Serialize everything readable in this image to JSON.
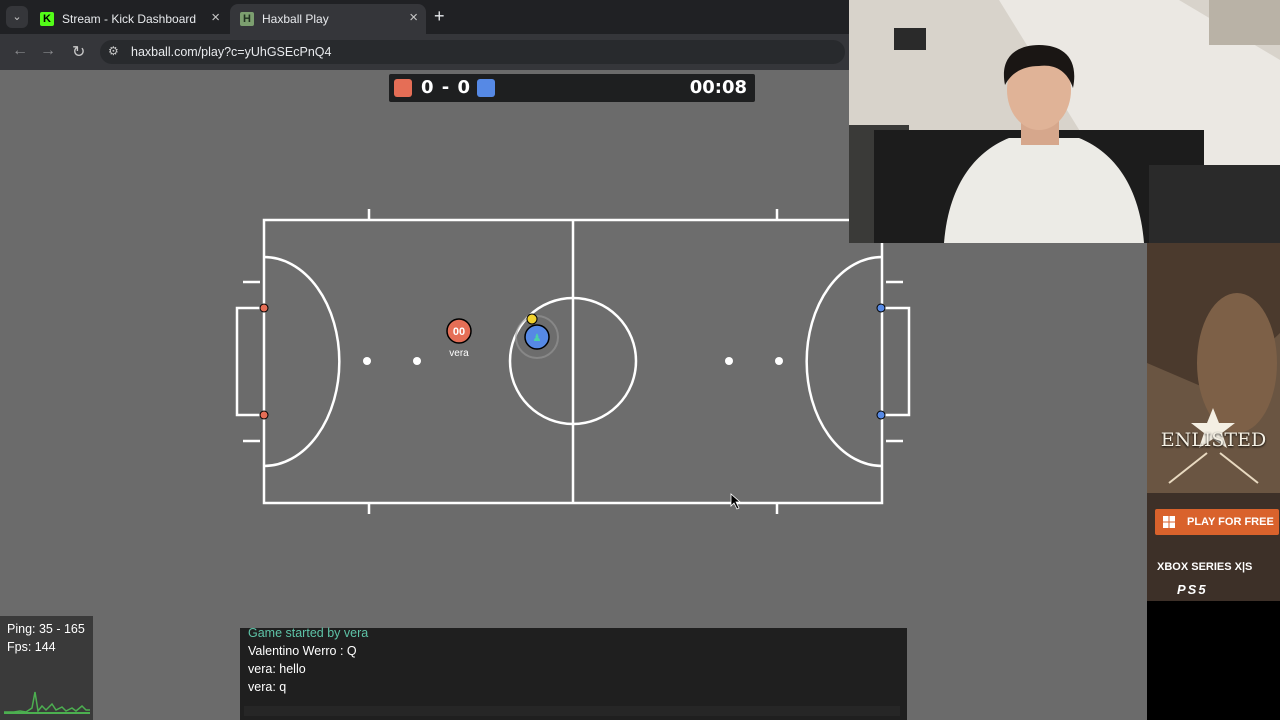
{
  "browser": {
    "tabs": [
      {
        "title": "Stream - Kick Dashboard",
        "favicon": "kick-icon",
        "active": false
      },
      {
        "title": "Haxball Play",
        "favicon": "haxball-icon",
        "active": true
      }
    ],
    "new_tab_glyph": "+",
    "close_glyph": "×",
    "url": "haxball.com/play?c=yUhGSEcPnQ4"
  },
  "game": {
    "scoreboard": {
      "red_score": "0",
      "separator": "-",
      "blue_score": "0",
      "score_text": "0 - 0",
      "timer": "00:08",
      "red_color": "#e56e56",
      "blue_color": "#5689e5"
    },
    "players": [
      {
        "name": "vera",
        "avatar": "00",
        "team": "red"
      },
      {
        "name": "",
        "avatar": "",
        "team": "blue"
      }
    ],
    "pitch_color": "#6b6b6b",
    "line_color": "#ffffff"
  },
  "stats": {
    "ping": "Ping: 35 - 165",
    "fps": "Fps: 144",
    "graph_color": "#4caf50"
  },
  "chat": {
    "notice": "Game started by vera",
    "messages": [
      "Valentino Werro : Q",
      "vera: hello",
      "vera: q"
    ]
  },
  "ad": {
    "title": "ENLISTED",
    "cta": "PLAY FOR FREE",
    "platform1": "XBOX SERIES X|S",
    "platform2": "PS5",
    "accent": "#d9622c"
  }
}
